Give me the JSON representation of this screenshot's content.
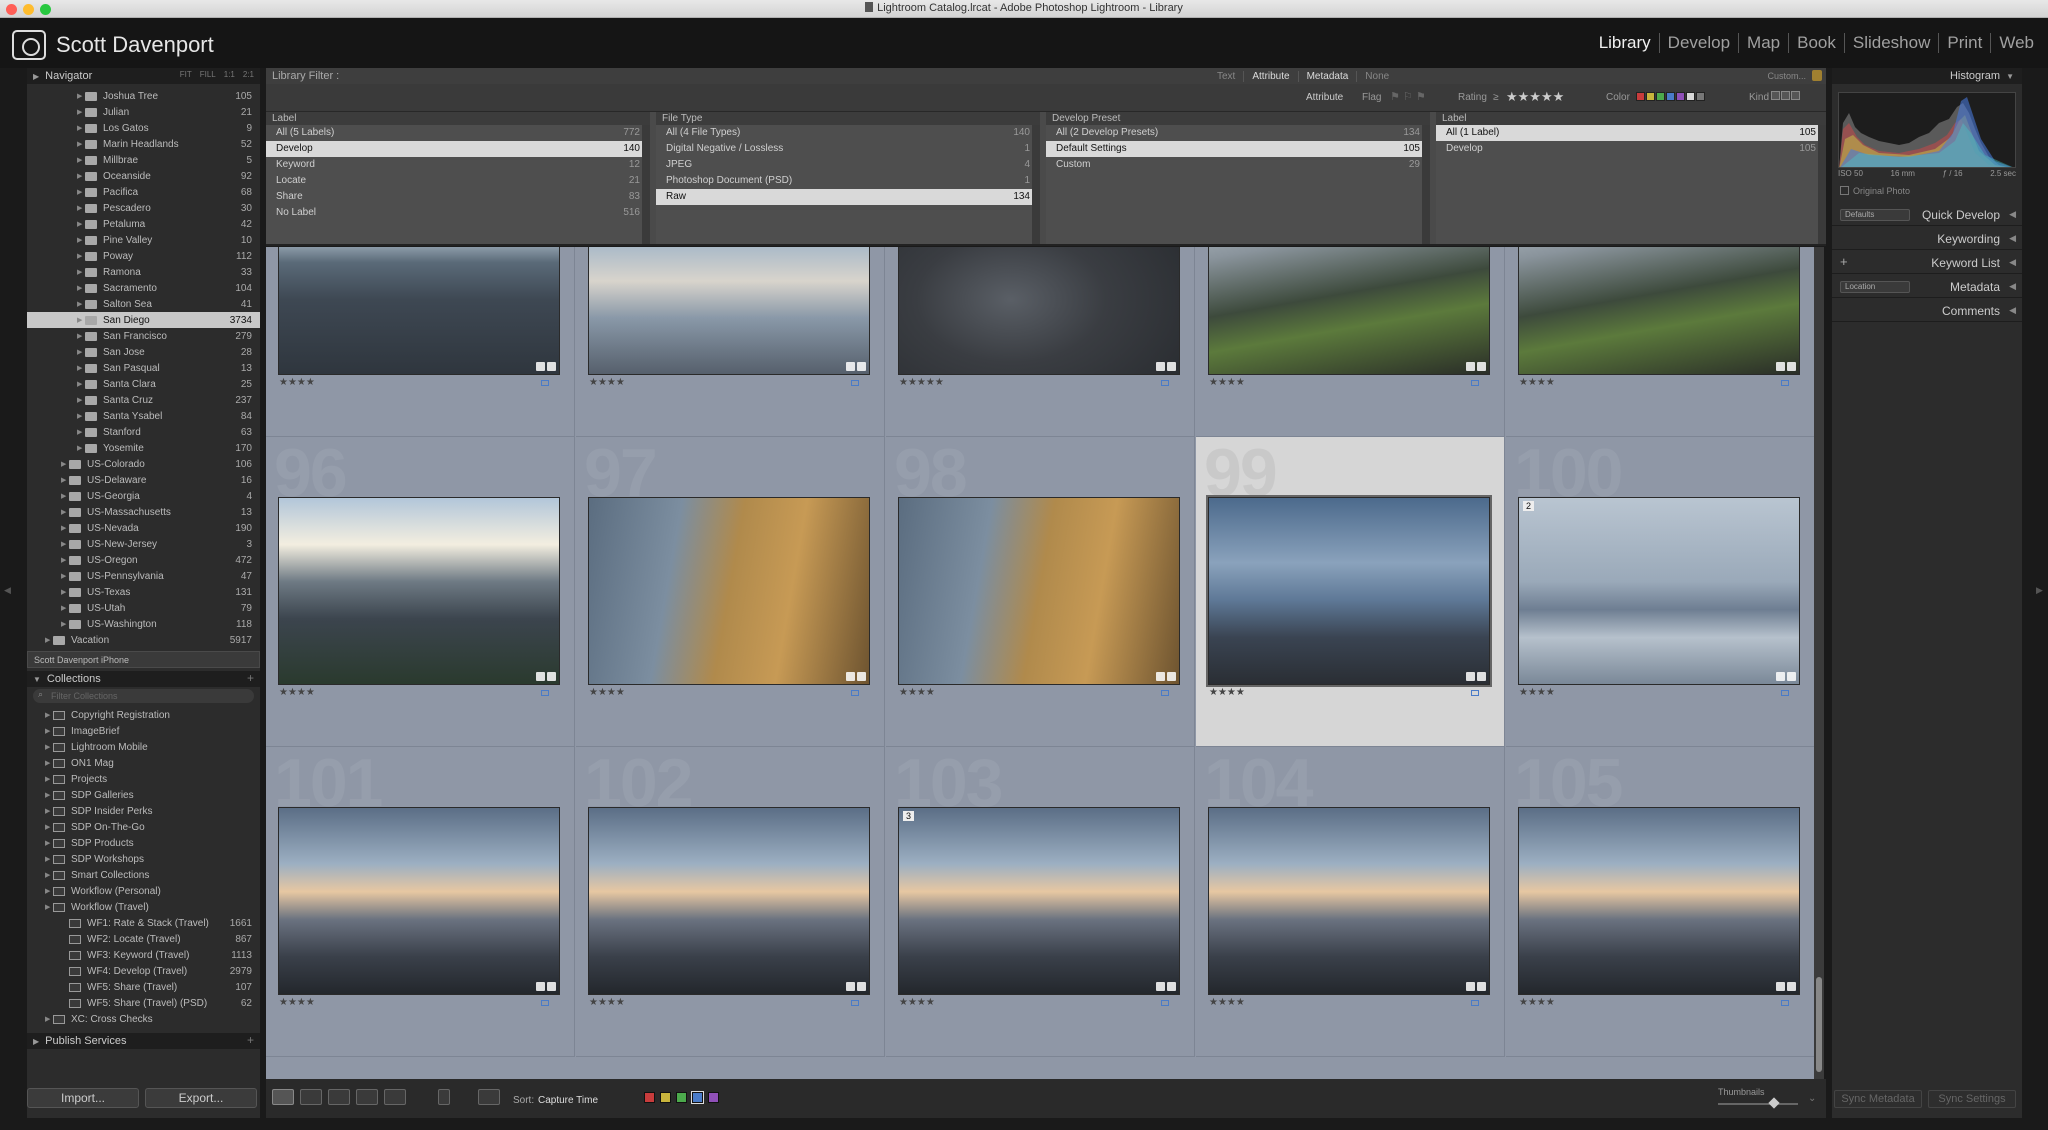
{
  "window": {
    "title": "Lightroom Catalog.lrcat - Adobe Photoshop Lightroom - Library",
    "traffic_colors": [
      "#ff5f57",
      "#febc2e",
      "#28c840"
    ]
  },
  "identity_plate": {
    "name": "Scott Davenport"
  },
  "modules": [
    "Library",
    "Develop",
    "Map",
    "Book",
    "Slideshow",
    "Print",
    "Web"
  ],
  "left_panel": {
    "navigator": {
      "title": "Navigator",
      "zoom_options": [
        "FIT",
        "FILL",
        "1:1",
        "2:1"
      ]
    },
    "folders": [
      {
        "name": "Joshua Tree",
        "count": "105",
        "level": 2
      },
      {
        "name": "Julian",
        "count": "21",
        "level": 2
      },
      {
        "name": "Los Gatos",
        "count": "9",
        "level": 2
      },
      {
        "name": "Marin Headlands",
        "count": "52",
        "level": 2
      },
      {
        "name": "Millbrae",
        "count": "5",
        "level": 2
      },
      {
        "name": "Oceanside",
        "count": "92",
        "level": 2
      },
      {
        "name": "Pacifica",
        "count": "68",
        "level": 2
      },
      {
        "name": "Pescadero",
        "count": "30",
        "level": 2
      },
      {
        "name": "Petaluma",
        "count": "42",
        "level": 2
      },
      {
        "name": "Pine Valley",
        "count": "10",
        "level": 2
      },
      {
        "name": "Poway",
        "count": "112",
        "level": 2
      },
      {
        "name": "Ramona",
        "count": "33",
        "level": 2
      },
      {
        "name": "Sacramento",
        "count": "104",
        "level": 2
      },
      {
        "name": "Salton Sea",
        "count": "41",
        "level": 2
      },
      {
        "name": "San Diego",
        "count": "3734",
        "level": 2,
        "selected": true
      },
      {
        "name": "San Francisco",
        "count": "279",
        "level": 2
      },
      {
        "name": "San Jose",
        "count": "28",
        "level": 2
      },
      {
        "name": "San Pasqual",
        "count": "13",
        "level": 2
      },
      {
        "name": "Santa Clara",
        "count": "25",
        "level": 2
      },
      {
        "name": "Santa Cruz",
        "count": "237",
        "level": 2
      },
      {
        "name": "Santa Ysabel",
        "count": "84",
        "level": 2
      },
      {
        "name": "Stanford",
        "count": "63",
        "level": 2
      },
      {
        "name": "Yosemite",
        "count": "170",
        "level": 2
      },
      {
        "name": "US-Colorado",
        "count": "106",
        "level": 1
      },
      {
        "name": "US-Delaware",
        "count": "16",
        "level": 1
      },
      {
        "name": "US-Georgia",
        "count": "4",
        "level": 1
      },
      {
        "name": "US-Massachusetts",
        "count": "13",
        "level": 1
      },
      {
        "name": "US-Nevada",
        "count": "190",
        "level": 1
      },
      {
        "name": "US-New-Jersey",
        "count": "3",
        "level": 1
      },
      {
        "name": "US-Oregon",
        "count": "472",
        "level": 1
      },
      {
        "name": "US-Pennsylvania",
        "count": "47",
        "level": 1
      },
      {
        "name": "US-Texas",
        "count": "131",
        "level": 1
      },
      {
        "name": "US-Utah",
        "count": "79",
        "level": 1
      },
      {
        "name": "US-Washington",
        "count": "118",
        "level": 1
      },
      {
        "name": "Vacation",
        "count": "5917",
        "level": 0
      }
    ],
    "device": "Scott Davenport iPhone",
    "collections": {
      "title": "Collections",
      "filter_placeholder": "Filter Collections",
      "items": [
        {
          "name": "Copyright Registration",
          "count": "",
          "level": 0
        },
        {
          "name": "ImageBrief",
          "count": "",
          "level": 0
        },
        {
          "name": "Lightroom Mobile",
          "count": "",
          "level": 0
        },
        {
          "name": "ON1 Mag",
          "count": "",
          "level": 0
        },
        {
          "name": "Projects",
          "count": "",
          "level": 0
        },
        {
          "name": "SDP Galleries",
          "count": "",
          "level": 0
        },
        {
          "name": "SDP Insider Perks",
          "count": "",
          "level": 0
        },
        {
          "name": "SDP On-The-Go",
          "count": "",
          "level": 0
        },
        {
          "name": "SDP Products",
          "count": "",
          "level": 0
        },
        {
          "name": "SDP Workshops",
          "count": "",
          "level": 0
        },
        {
          "name": "Smart Collections",
          "count": "",
          "level": 0
        },
        {
          "name": "Workflow (Personal)",
          "count": "",
          "level": 0
        },
        {
          "name": "Workflow (Travel)",
          "count": "",
          "level": 0
        },
        {
          "name": "WF1: Rate & Stack (Travel)",
          "count": "1661",
          "level": 1
        },
        {
          "name": "WF2: Locate (Travel)",
          "count": "867",
          "level": 1
        },
        {
          "name": "WF3: Keyword (Travel)",
          "count": "1113",
          "level": 1
        },
        {
          "name": "WF4: Develop (Travel)",
          "count": "2979",
          "level": 1
        },
        {
          "name": "WF5: Share (Travel)",
          "count": "107",
          "level": 1
        },
        {
          "name": "WF5: Share (Travel) (PSD)",
          "count": "62",
          "level": 1
        },
        {
          "name": "XC: Cross Checks",
          "count": "",
          "level": 0
        }
      ]
    },
    "publish_services": "Publish Services",
    "import_label": "Import...",
    "export_label": "Export..."
  },
  "filter_bar": {
    "title": "Library Filter :",
    "tabs": [
      "Text",
      "Attribute",
      "Metadata",
      "None"
    ],
    "preset": "Custom..."
  },
  "attribute_bar": {
    "attribute": "Attribute",
    "flag": "Flag",
    "rating": "Rating",
    "rating_op": "≥",
    "stars": "★★★★★",
    "color": "Color",
    "kind": "Kind",
    "swatches": [
      "#c83c3c",
      "#c8b43c",
      "#4caa4c",
      "#4a7bc8",
      "#9050b8",
      "#d8d8d8",
      "#777777"
    ]
  },
  "metadata_columns": [
    {
      "header": "Label",
      "rows": [
        {
          "label": "All (5 Labels)",
          "count": "772"
        },
        {
          "label": "Develop",
          "count": "140",
          "selected": true
        },
        {
          "label": "Keyword",
          "count": "12"
        },
        {
          "label": "Locate",
          "count": "21"
        },
        {
          "label": "Share",
          "count": "83"
        },
        {
          "label": "No Label",
          "count": "516"
        }
      ]
    },
    {
      "header": "File Type",
      "rows": [
        {
          "label": "All (4 File Types)",
          "count": "140"
        },
        {
          "label": "Digital Negative / Lossless",
          "count": "1"
        },
        {
          "label": "JPEG",
          "count": "4"
        },
        {
          "label": "Photoshop Document (PSD)",
          "count": "1"
        },
        {
          "label": "Raw",
          "count": "134",
          "selected": true
        }
      ]
    },
    {
      "header": "Develop Preset",
      "rows": [
        {
          "label": "All (2 Develop Presets)",
          "count": "134"
        },
        {
          "label": "Default Settings",
          "count": "105",
          "selected": true
        },
        {
          "label": "Custom",
          "count": "29"
        }
      ]
    },
    {
      "header": "Label",
      "rows": [
        {
          "label": "All (1 Label)",
          "count": "105",
          "selected": true
        },
        {
          "label": "Develop",
          "count": "105"
        }
      ]
    }
  ],
  "grid": {
    "cells": [
      {
        "index": "",
        "stars": "★★★★",
        "variant": "beach-rocks"
      },
      {
        "index": "",
        "stars": "★★★★",
        "variant": "reflection"
      },
      {
        "index": "",
        "stars": "★★★★★",
        "variant": "dark-rocks"
      },
      {
        "index": "",
        "stars": "★★★★",
        "variant": "wave-green"
      },
      {
        "index": "",
        "stars": "★★★★",
        "variant": "wave-green"
      },
      {
        "index": "96",
        "stars": "★★★★",
        "variant": "sunset-rocks"
      },
      {
        "index": "97",
        "stars": "★★★★",
        "variant": "cliffs"
      },
      {
        "index": "98",
        "stars": "★★★★",
        "variant": "cliffs"
      },
      {
        "index": "99",
        "stars": "★★★★",
        "variant": "blue-sky",
        "selected": true
      },
      {
        "index": "100",
        "stars": "★★★★",
        "variant": "pier",
        "badge": "2"
      },
      {
        "index": "101",
        "stars": "★★★★",
        "variant": "sunset-shore"
      },
      {
        "index": "102",
        "stars": "★★★★",
        "variant": "sunset-shore"
      },
      {
        "index": "103",
        "stars": "★★★★",
        "variant": "sunset-shore",
        "badge": "3"
      },
      {
        "index": "104",
        "stars": "★★★★",
        "variant": "sunset-shore"
      },
      {
        "index": "105",
        "stars": "★★★★",
        "variant": "sunset-shore"
      }
    ]
  },
  "toolbar": {
    "sort_label": "Sort:",
    "sort_value": "Capture Time",
    "color_swatches": [
      "#c83c3c",
      "#c8b43c",
      "#4caa4c",
      "#4a7bc8",
      "#9050b8"
    ],
    "thumbnails_label": "Thumbnails"
  },
  "right_panel": {
    "histogram_title": "Histogram",
    "iso": "ISO 50",
    "focal": "16 mm",
    "aperture": "ƒ / 16",
    "shutter": "2.5 sec",
    "original_photo": "Original Photo",
    "sections": [
      {
        "name": "Quick Develop",
        "dropdown": "Defaults"
      },
      {
        "name": "Keywording"
      },
      {
        "name": "Keyword List",
        "plus": "+"
      },
      {
        "name": "Metadata",
        "dropdown": "Location"
      },
      {
        "name": "Comments"
      }
    ],
    "sync_metadata": "Sync Metadata",
    "sync_settings": "Sync Settings"
  }
}
